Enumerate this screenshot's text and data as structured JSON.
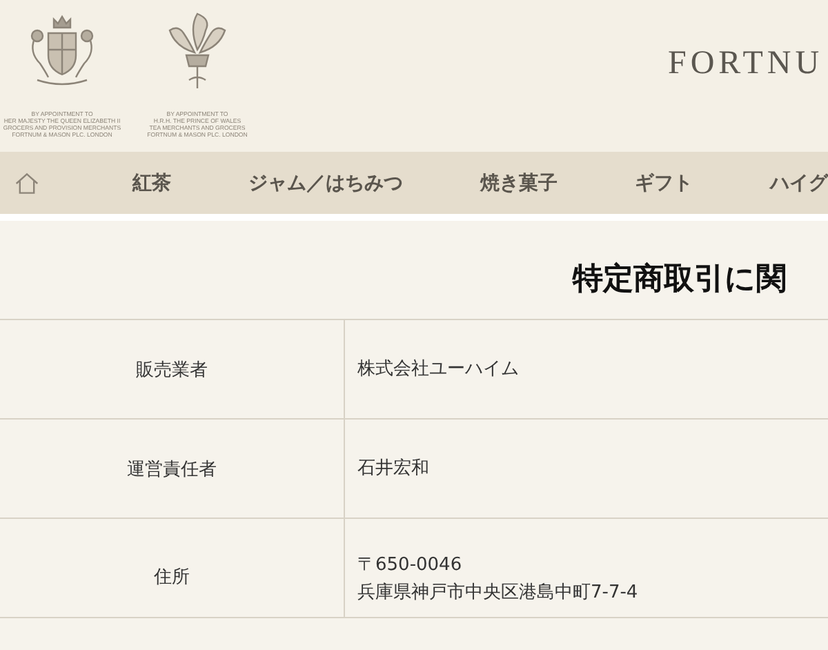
{
  "header": {
    "warrants": [
      {
        "kind": "crest",
        "lines": [
          "BY APPOINTMENT TO",
          "HER MAJESTY THE QUEEN ELIZABETH II",
          "GROCERS AND PROVISION MERCHANTS",
          "FORTNUM & MASON PLC. LONDON"
        ]
      },
      {
        "kind": "feathers",
        "lines": [
          "BY APPOINTMENT TO",
          "H.R.H. THE PRINCE OF WALES",
          "TEA MERCHANTS AND GROCERS",
          "FORTNUM & MASON PLC. LONDON"
        ]
      }
    ],
    "brand": "FORTNU"
  },
  "nav": {
    "items": [
      "紅茶",
      "ジャム／はちみつ",
      "焼き菓子",
      "ギフト",
      "ハイグ"
    ]
  },
  "page_title": "特定商取引に関",
  "table": {
    "rows": [
      {
        "label": "販売業者",
        "value": [
          "株式会社ユーハイム"
        ]
      },
      {
        "label": "運営責任者",
        "value": [
          "石井宏和"
        ]
      },
      {
        "label": "住所",
        "value": [
          "〒650-0046",
          "兵庫県神戸市中央区港島中町7-7-4"
        ]
      }
    ]
  }
}
